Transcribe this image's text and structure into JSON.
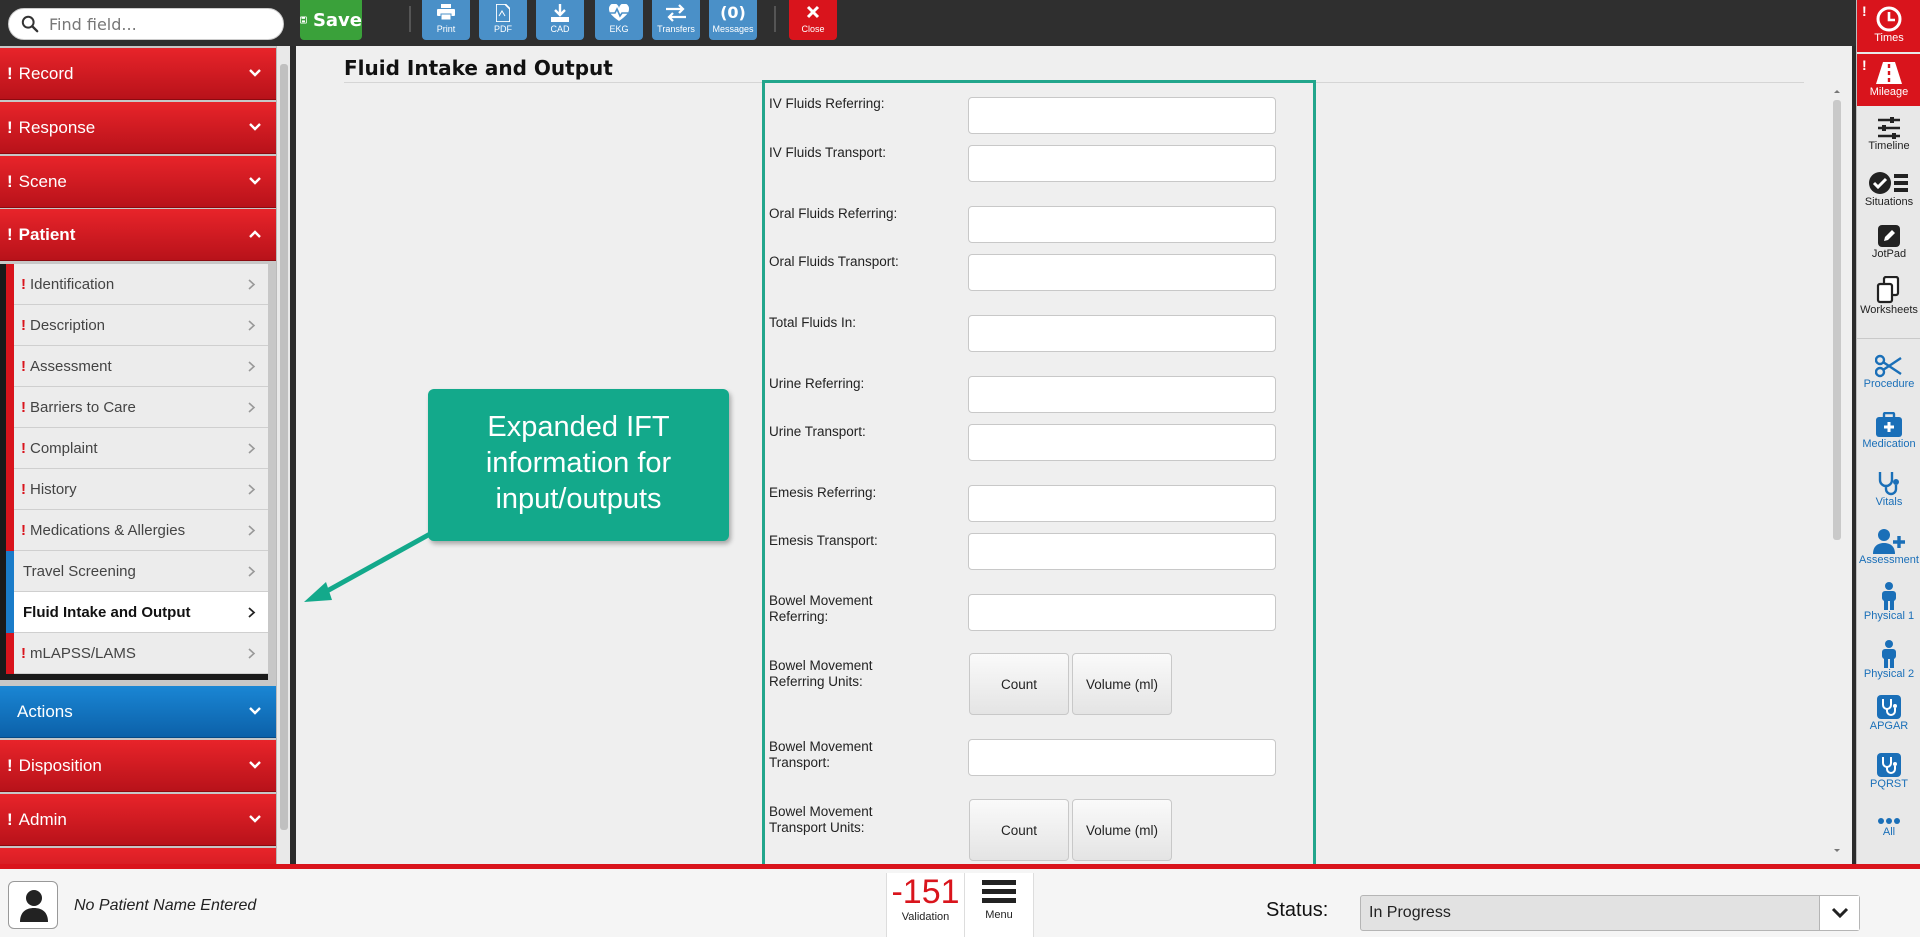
{
  "search": {
    "placeholder": "Find field..."
  },
  "toolbar": {
    "save_label": "Save",
    "print_label": "Print",
    "pdf_label": "PDF",
    "cad_label": "CAD",
    "ekg_label": "EKG",
    "transfers_label": "Transfers",
    "messages_count": "(0)",
    "messages_label": "Messages",
    "close_label": "Close"
  },
  "leftnav": {
    "sections": [
      {
        "label": "Record",
        "alert": "!"
      },
      {
        "label": "Response",
        "alert": "!"
      },
      {
        "label": "Scene",
        "alert": "!"
      },
      {
        "label": "Patient",
        "alert": "!"
      }
    ],
    "patient_items": [
      {
        "label": "Identification",
        "alert": "!"
      },
      {
        "label": "Description",
        "alert": "!"
      },
      {
        "label": "Assessment",
        "alert": "!"
      },
      {
        "label": "Barriers to Care",
        "alert": "!"
      },
      {
        "label": "Complaint",
        "alert": "!"
      },
      {
        "label": "History",
        "alert": "!"
      },
      {
        "label": "Medications & Allergies",
        "alert": "!"
      },
      {
        "label": "Travel Screening"
      },
      {
        "label": "Fluid Intake and Output"
      },
      {
        "label": "mLAPSS/LAMS",
        "alert": "!"
      }
    ],
    "lower_sections": [
      {
        "label": "Actions"
      },
      {
        "label": "Disposition",
        "alert": "!"
      },
      {
        "label": "Admin",
        "alert": "!"
      }
    ]
  },
  "main": {
    "title": "Fluid Intake and Output",
    "fields": [
      {
        "label": "IV Fluids Referring:"
      },
      {
        "label": "IV Fluids Transport:"
      },
      {
        "label": "Oral Fluids Referring:"
      },
      {
        "label": "Oral Fluids Transport:"
      },
      {
        "label": "Total Fluids In:"
      },
      {
        "label": "Urine Referring:"
      },
      {
        "label": "Urine Transport:"
      },
      {
        "label": "Emesis Referring:"
      },
      {
        "label": "Emesis Transport:"
      },
      {
        "label": "Bowel Movement Referring:"
      },
      {
        "label": "Bowel Movement Referring Units:"
      },
      {
        "label": "Bowel Movement Transport:"
      },
      {
        "label": "Bowel Movement Transport Units:"
      }
    ],
    "unit_options": [
      "Count",
      "Volume (ml)"
    ],
    "callout": "Expanded IFT information for input/outputs"
  },
  "rail": {
    "items": [
      {
        "label": "Times",
        "icon": "clock-icon",
        "alert": "!"
      },
      {
        "label": "Mileage",
        "icon": "road-icon",
        "alert": "!"
      },
      {
        "label": "Timeline",
        "icon": "sliders-icon"
      },
      {
        "label": "Situations",
        "icon": "checklist-icon"
      },
      {
        "label": "JotPad",
        "icon": "pencil-icon"
      },
      {
        "label": "Worksheets",
        "icon": "copy-icon"
      },
      {
        "label": "Procedure",
        "icon": "scissors-icon"
      },
      {
        "label": "Medication",
        "icon": "medkit-icon"
      },
      {
        "label": "Vitals",
        "icon": "stethoscope-icon"
      },
      {
        "label": "Assessment",
        "icon": "user-plus-icon"
      },
      {
        "label": "Physical 1",
        "icon": "person-icon"
      },
      {
        "label": "Physical 2",
        "icon": "person-icon"
      },
      {
        "label": "APGAR",
        "icon": "stethoscope-icon"
      },
      {
        "label": "PQRST",
        "icon": "stethoscope-icon"
      },
      {
        "label": "All",
        "icon": "more-icon"
      }
    ]
  },
  "bottom": {
    "patient_name": "No Patient Name Entered",
    "validation_value": "-151",
    "validation_label": "Validation",
    "menu_label": "Menu",
    "status_label": "Status:",
    "status_value": "In Progress"
  },
  "colors": {
    "red": "#d9141c",
    "blue": "#1a7cc9",
    "green": "#3aa13a",
    "teal": "#13a98b"
  }
}
